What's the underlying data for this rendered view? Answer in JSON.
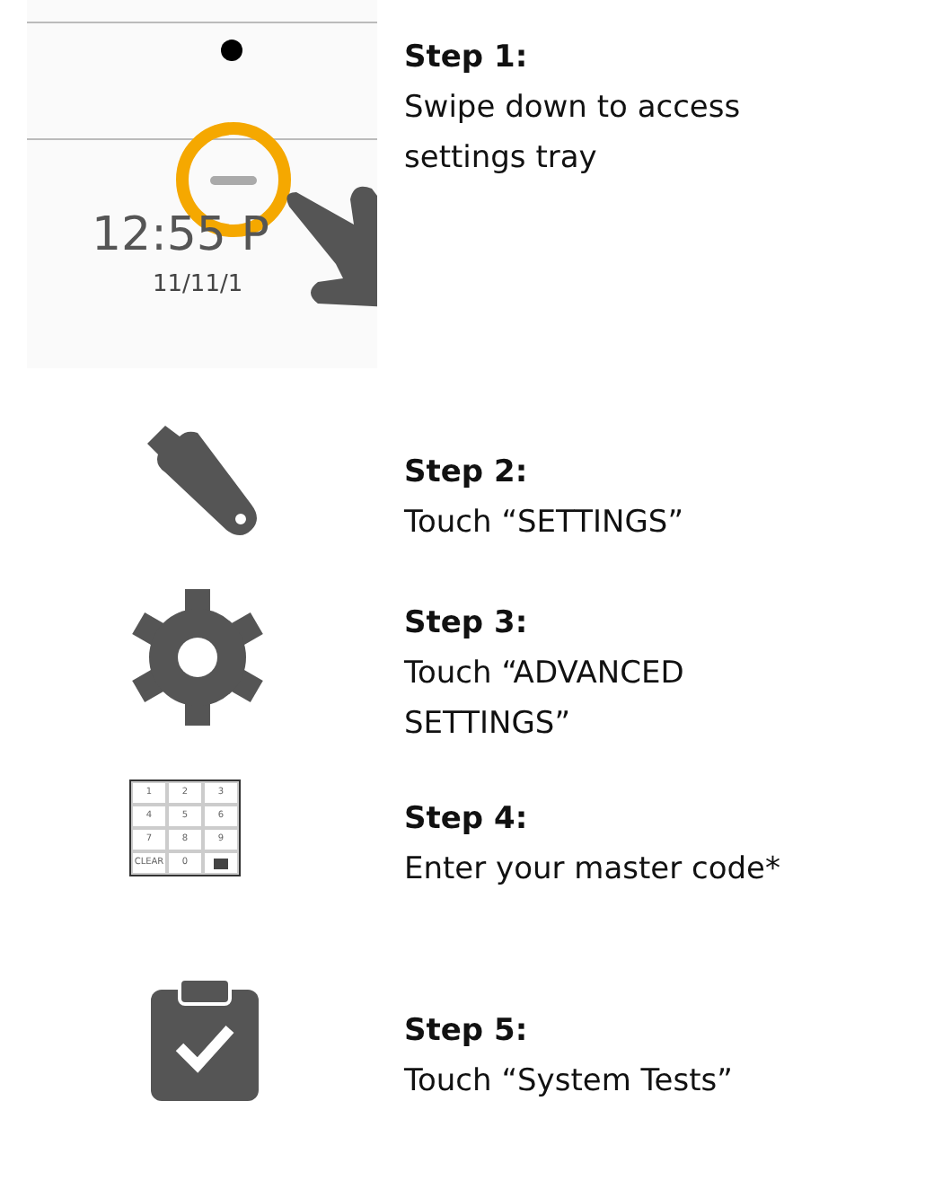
{
  "steps": [
    {
      "kind": "swipe",
      "heading": "Step 1:",
      "text": "Swipe down to access settings tray",
      "time": "12:55 P",
      "date": "11/11/1"
    },
    {
      "kind": "wrench",
      "heading": "Step 2:",
      "text": "Touch “SETTINGS”"
    },
    {
      "kind": "gear",
      "heading": "Step 3:",
      "text": "Touch “ADVANCED SETTINGS”"
    },
    {
      "kind": "keypad",
      "heading": "Step 4:",
      "text": "Enter your master code*",
      "keys": [
        "1",
        "2",
        "3",
        "4",
        "5",
        "6",
        "7",
        "8",
        "9",
        "CLEAR",
        "0"
      ]
    },
    {
      "kind": "clipboard",
      "heading": "Step 5:",
      "text": "Touch “System Tests”"
    }
  ]
}
